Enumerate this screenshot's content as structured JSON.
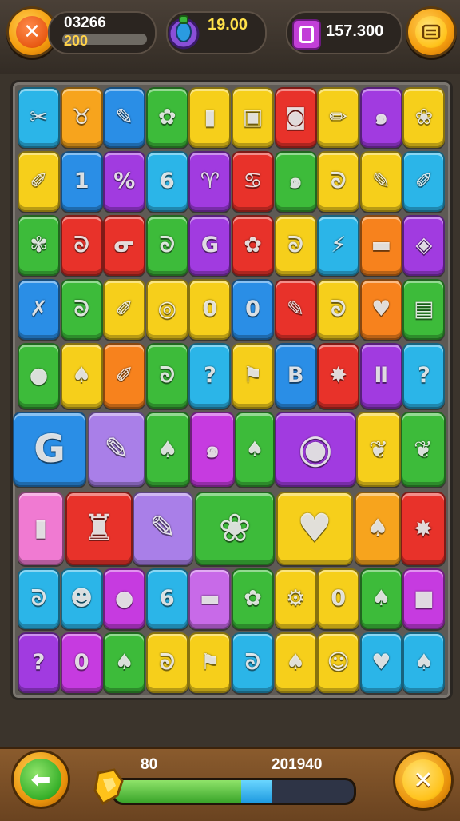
{
  "hud": {
    "score": "03266",
    "level": "200",
    "gems": "19.00",
    "coins": "157.300"
  },
  "icons": {
    "close": "close-x-icon",
    "menu": "menu-icon",
    "back": "back-arrow-icon",
    "gem": "potion-gem-icon",
    "coin": "purple-coin-icon",
    "progress": "golden-star-icon"
  },
  "progress": {
    "left_label": "80",
    "right_label": "201940",
    "green_fraction": 0.54,
    "blue_fraction": 0.13
  },
  "board": {
    "rows": [
      [
        "✂",
        "♉",
        "✎",
        "✿",
        "▮",
        "▣",
        "◙",
        "✏",
        "๑",
        "❀"
      ],
      [
        "✐",
        "1",
        "%",
        "6",
        "♈",
        "♋",
        "๑",
        "ᘐ",
        "✎",
        "✐"
      ],
      [
        "✾",
        "ᘐ",
        "ᓂ",
        "ᘐ",
        "G",
        "✿",
        "ᘐ",
        "⚡",
        "▬",
        "◈"
      ],
      [
        "✗",
        "ᘐ",
        "✐",
        "◎",
        "0",
        "0",
        "✎",
        "ᘐ",
        "♥",
        "▤"
      ],
      [
        "●",
        "♠",
        "✐",
        "ᘐ",
        "?",
        "⚑",
        "B",
        "✸",
        "Ⅱ",
        "?"
      ],
      [
        "G",
        "✎",
        "♠",
        "๑",
        "♠",
        "◉",
        "❦",
        "❦"
      ],
      [
        "▮",
        "♜",
        "✎",
        "❀",
        "♥",
        "♠",
        "✸"
      ],
      [
        "ᘐ",
        "☻",
        "●",
        "6",
        "▬",
        "✿",
        "⚙",
        "0",
        "♠",
        "■"
      ],
      [
        "?",
        "0",
        "♠",
        "ᘐ",
        "⚑",
        "ᘐ",
        "♠",
        "☺",
        "♥",
        "♠"
      ]
    ],
    "colors": [
      [
        "#2bb5e8",
        "#f7a41d",
        "#2a8ee6",
        "#3dbb3a",
        "#f6cf1b",
        "#f6cf1b",
        "#e8322a",
        "#f6cf1b",
        "#a13be0",
        "#f6cf1b"
      ],
      [
        "#f6cf1b",
        "#2a8ee6",
        "#a13be0",
        "#2bb5e8",
        "#a13be0",
        "#e8322a",
        "#3dbb3a",
        "#f6cf1b",
        "#f6cf1b",
        "#2bb5e8"
      ],
      [
        "#3dbb3a",
        "#e8322a",
        "#e8322a",
        "#3dbb3a",
        "#a13be0",
        "#e8322a",
        "#f6cf1b",
        "#2bb5e8",
        "#f7821d",
        "#a13be0"
      ],
      [
        "#2a8ee6",
        "#3dbb3a",
        "#f6cf1b",
        "#f6cf1b",
        "#f6cf1b",
        "#2a8ee6",
        "#e8322a",
        "#f6cf1b",
        "#f7821d",
        "#3dbb3a"
      ],
      [
        "#3dbb3a",
        "#f6cf1b",
        "#f7821d",
        "#3dbb3a",
        "#2bb5e8",
        "#f6cf1b",
        "#2a8ee6",
        "#e8322a",
        "#a13be0",
        "#2bb5e8"
      ],
      [
        "#2a8ee6",
        "#a97fe8",
        "#3dbb3a",
        "#c63be0",
        "#3dbb3a",
        "#a13be0",
        "#f6cf1b",
        "#3dbb3a"
      ],
      [
        "#f07ad2",
        "#e8322a",
        "#a97fe8",
        "#3dbb3a",
        "#f6cf1b",
        "#f7a41d",
        "#e8322a"
      ],
      [
        "#2bb5e8",
        "#2bb5e8",
        "#c63be0",
        "#2bb5e8",
        "#c86ae8",
        "#3dbb3a",
        "#f6cf1b",
        "#f6cf1b",
        "#3dbb3a",
        "#c63be0"
      ],
      [
        "#a13be0",
        "#c63be0",
        "#3dbb3a",
        "#f6cf1b",
        "#f6cf1b",
        "#2bb5e8",
        "#f6cf1b",
        "#f6cf1b",
        "#2bb5e8",
        "#2bb5e8"
      ]
    ]
  }
}
